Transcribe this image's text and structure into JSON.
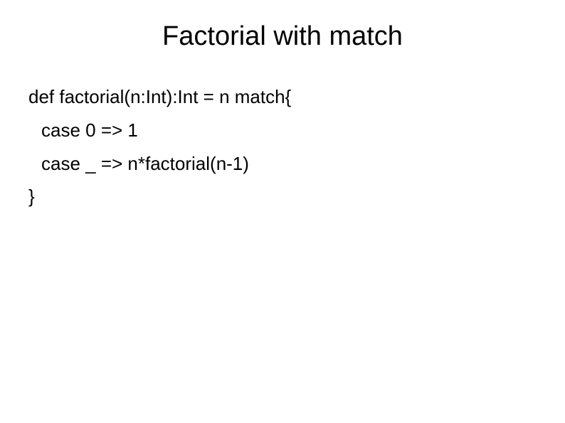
{
  "title": "Factorial with match",
  "code": {
    "line1": "def factorial(n:Int):Int = n match{",
    "line2": "case 0 => 1",
    "line3": "case _ => n*factorial(n-1)",
    "line4": "}"
  }
}
